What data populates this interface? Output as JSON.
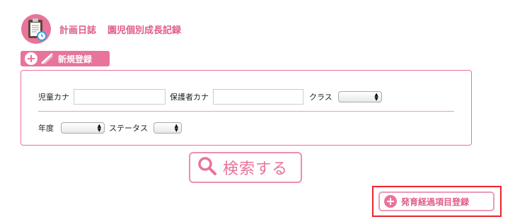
{
  "header": {
    "icon": "clipboard-icon",
    "title": "計画日誌",
    "subtitle": "園児個別成長記録"
  },
  "new_button": {
    "icons": [
      "plus-icon",
      "pencil-icon"
    ],
    "label": "新規登録"
  },
  "search_form": {
    "child_kana_label": "児童カナ",
    "child_kana_value": "",
    "guardian_kana_label": "保護者カナ",
    "guardian_kana_value": "",
    "class_label": "クラス",
    "class_value": "",
    "year_label": "年度",
    "year_value": "",
    "status_label": "ステータス",
    "status_value": ""
  },
  "search_button": {
    "icon": "magnifier-icon",
    "label": "検索する"
  },
  "register_button": {
    "icon": "plus-icon",
    "label": "発育経過項目登録"
  },
  "colors": {
    "accent": "#e8739b",
    "accent_text": "#e05c8a",
    "highlight": "#e8242d"
  }
}
